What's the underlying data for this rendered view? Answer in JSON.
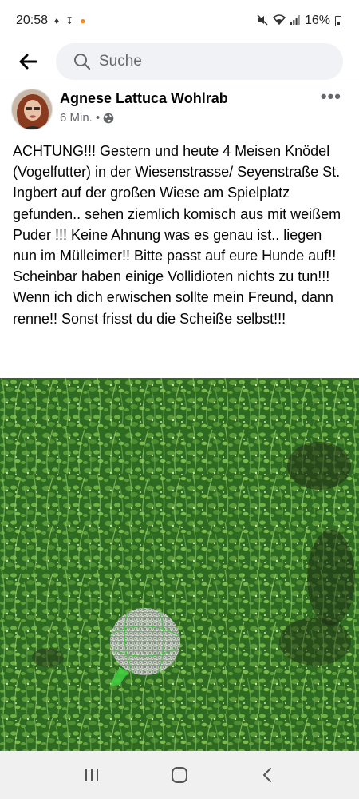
{
  "status_bar": {
    "time": "20:58",
    "battery": "16%",
    "icons_left": [
      "notification-icon",
      "download-icon",
      "app-badge-icon"
    ],
    "icons_right": [
      "mute-icon",
      "wifi-icon",
      "signal-icon",
      "battery-icon"
    ]
  },
  "header": {
    "back_icon": "back-arrow-icon",
    "search_placeholder": "Suche"
  },
  "post": {
    "author": "Agnese Lattuca Wohlrab",
    "time": "6 Min.",
    "separator": "•",
    "audience_icon": "globe-icon",
    "more_icon": "more-icon",
    "text": "ACHTUNG!!! Gestern und heute 4 Meisen Knödel (Vogelfutter) in der Wiesenstrasse/ Seyenstraße St. Ingbert auf der großen Wiese am Spielplatz gefunden.. sehen ziemlich komisch aus mit weißem Puder !!! Keine Ahnung was es genau ist.. liegen nun im Mülleimer!! Bitte passt auf eure Hunde auf!! Scheinbar haben einige Vollidioten nichts zu tun!!! Wenn ich dich erwischen sollte mein Freund, dann renne!! Sonst frisst du die Scheiße selbst!!!"
  },
  "nav": {
    "buttons": [
      "recents-icon",
      "home-icon",
      "back-icon"
    ]
  },
  "colors": {
    "text": "#050505",
    "secondary_text": "#65676b",
    "search_bg": "#f0f2f5",
    "grass": "#3f7a2a"
  }
}
